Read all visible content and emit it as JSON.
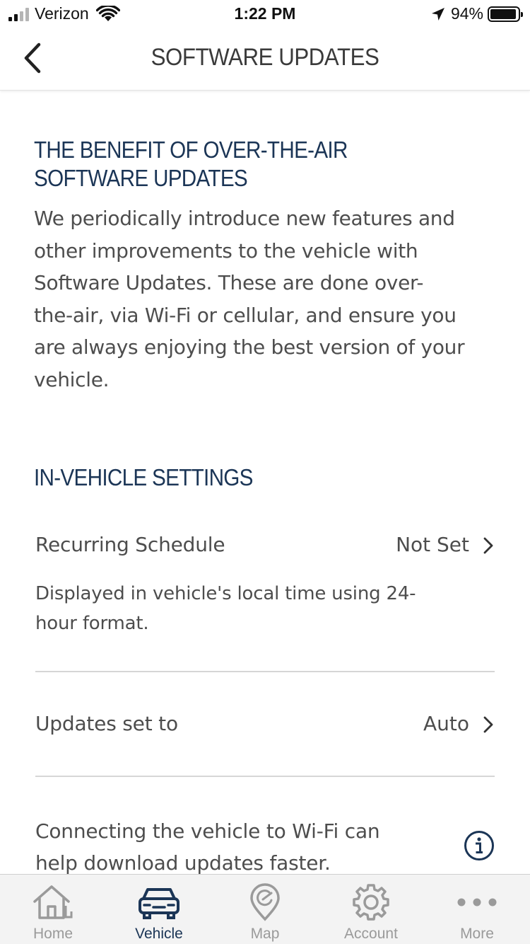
{
  "status_bar": {
    "carrier": "Verizon",
    "time": "1:22 PM",
    "battery_percent": "94%"
  },
  "nav": {
    "title": "SOFTWARE UPDATES"
  },
  "benefit": {
    "title_line1": "THE BENEFIT OF OVER-THE-AIR",
    "title_line2": "SOFTWARE UPDATES",
    "body_lines": [
      "We periodically introduce new features and",
      "other improvements to the vehicle with",
      "Software Updates. These are done over-",
      "the-air, via Wi-Fi or cellular, and ensure you",
      "are always enjoying the best version of your",
      "vehicle."
    ]
  },
  "settings": {
    "title": "IN-VEHICLE SETTINGS",
    "recurring_schedule": {
      "label": "Recurring Schedule",
      "value": "Not Set",
      "helper_line1": "Displayed in vehicle's local time using 24-",
      "helper_line2": "hour format."
    },
    "updates_set_to": {
      "label": "Updates set to",
      "value": "Auto"
    },
    "wifi_note_line1": "Connecting the vehicle to Wi-Fi can",
    "wifi_note_line2": "help download updates faster."
  },
  "tabs": [
    {
      "label": "Home",
      "icon": "home-icon",
      "active": false
    },
    {
      "label": "Vehicle",
      "icon": "car-icon",
      "active": true
    },
    {
      "label": "Map",
      "icon": "map-pin-icon",
      "active": false
    },
    {
      "label": "Account",
      "icon": "gear-icon",
      "active": false
    },
    {
      "label": "More",
      "icon": "more-dots-icon",
      "active": false
    }
  ],
  "colors": {
    "heading": "#1b3556",
    "body_text": "#4d4d4d",
    "tab_inactive": "#9a9a9a",
    "tab_active": "#1b3556",
    "tab_bar_bg": "#f3f3f3"
  }
}
